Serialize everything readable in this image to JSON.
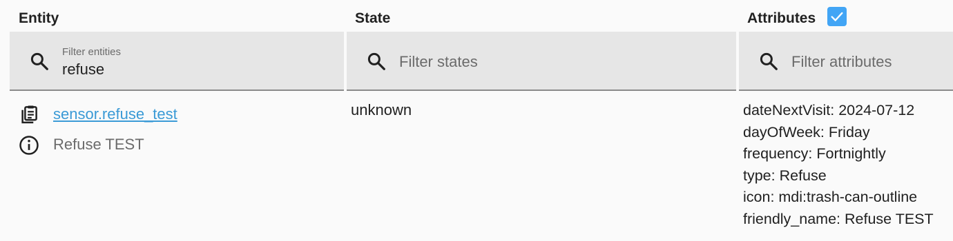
{
  "columns": {
    "entity": "Entity",
    "state": "State",
    "attributes": "Attributes"
  },
  "attributes_toggle": {
    "checked": true
  },
  "filters": {
    "entities": {
      "label": "Filter entities",
      "value": "refuse"
    },
    "states": {
      "placeholder": "Filter states"
    },
    "attributes": {
      "placeholder": "Filter attributes"
    }
  },
  "row": {
    "entity_id": "sensor.refuse_test",
    "friendly_name": "Refuse TEST",
    "state": "unknown",
    "attributes": [
      "dateNextVisit: 2024-07-12",
      "dayOfWeek: Friday",
      "frequency: Fortnightly",
      "type: Refuse",
      "icon: mdi:trash-can-outline",
      "friendly_name: Refuse TEST"
    ]
  },
  "icons": [
    "search-icon",
    "clipboard-icon",
    "info-icon",
    "checkmark-icon"
  ],
  "colors": {
    "link": "#3a9ad6",
    "checkbox": "#42a5f5",
    "filter_bg": "#e6e6e6",
    "page_bg": "#fafafa"
  }
}
